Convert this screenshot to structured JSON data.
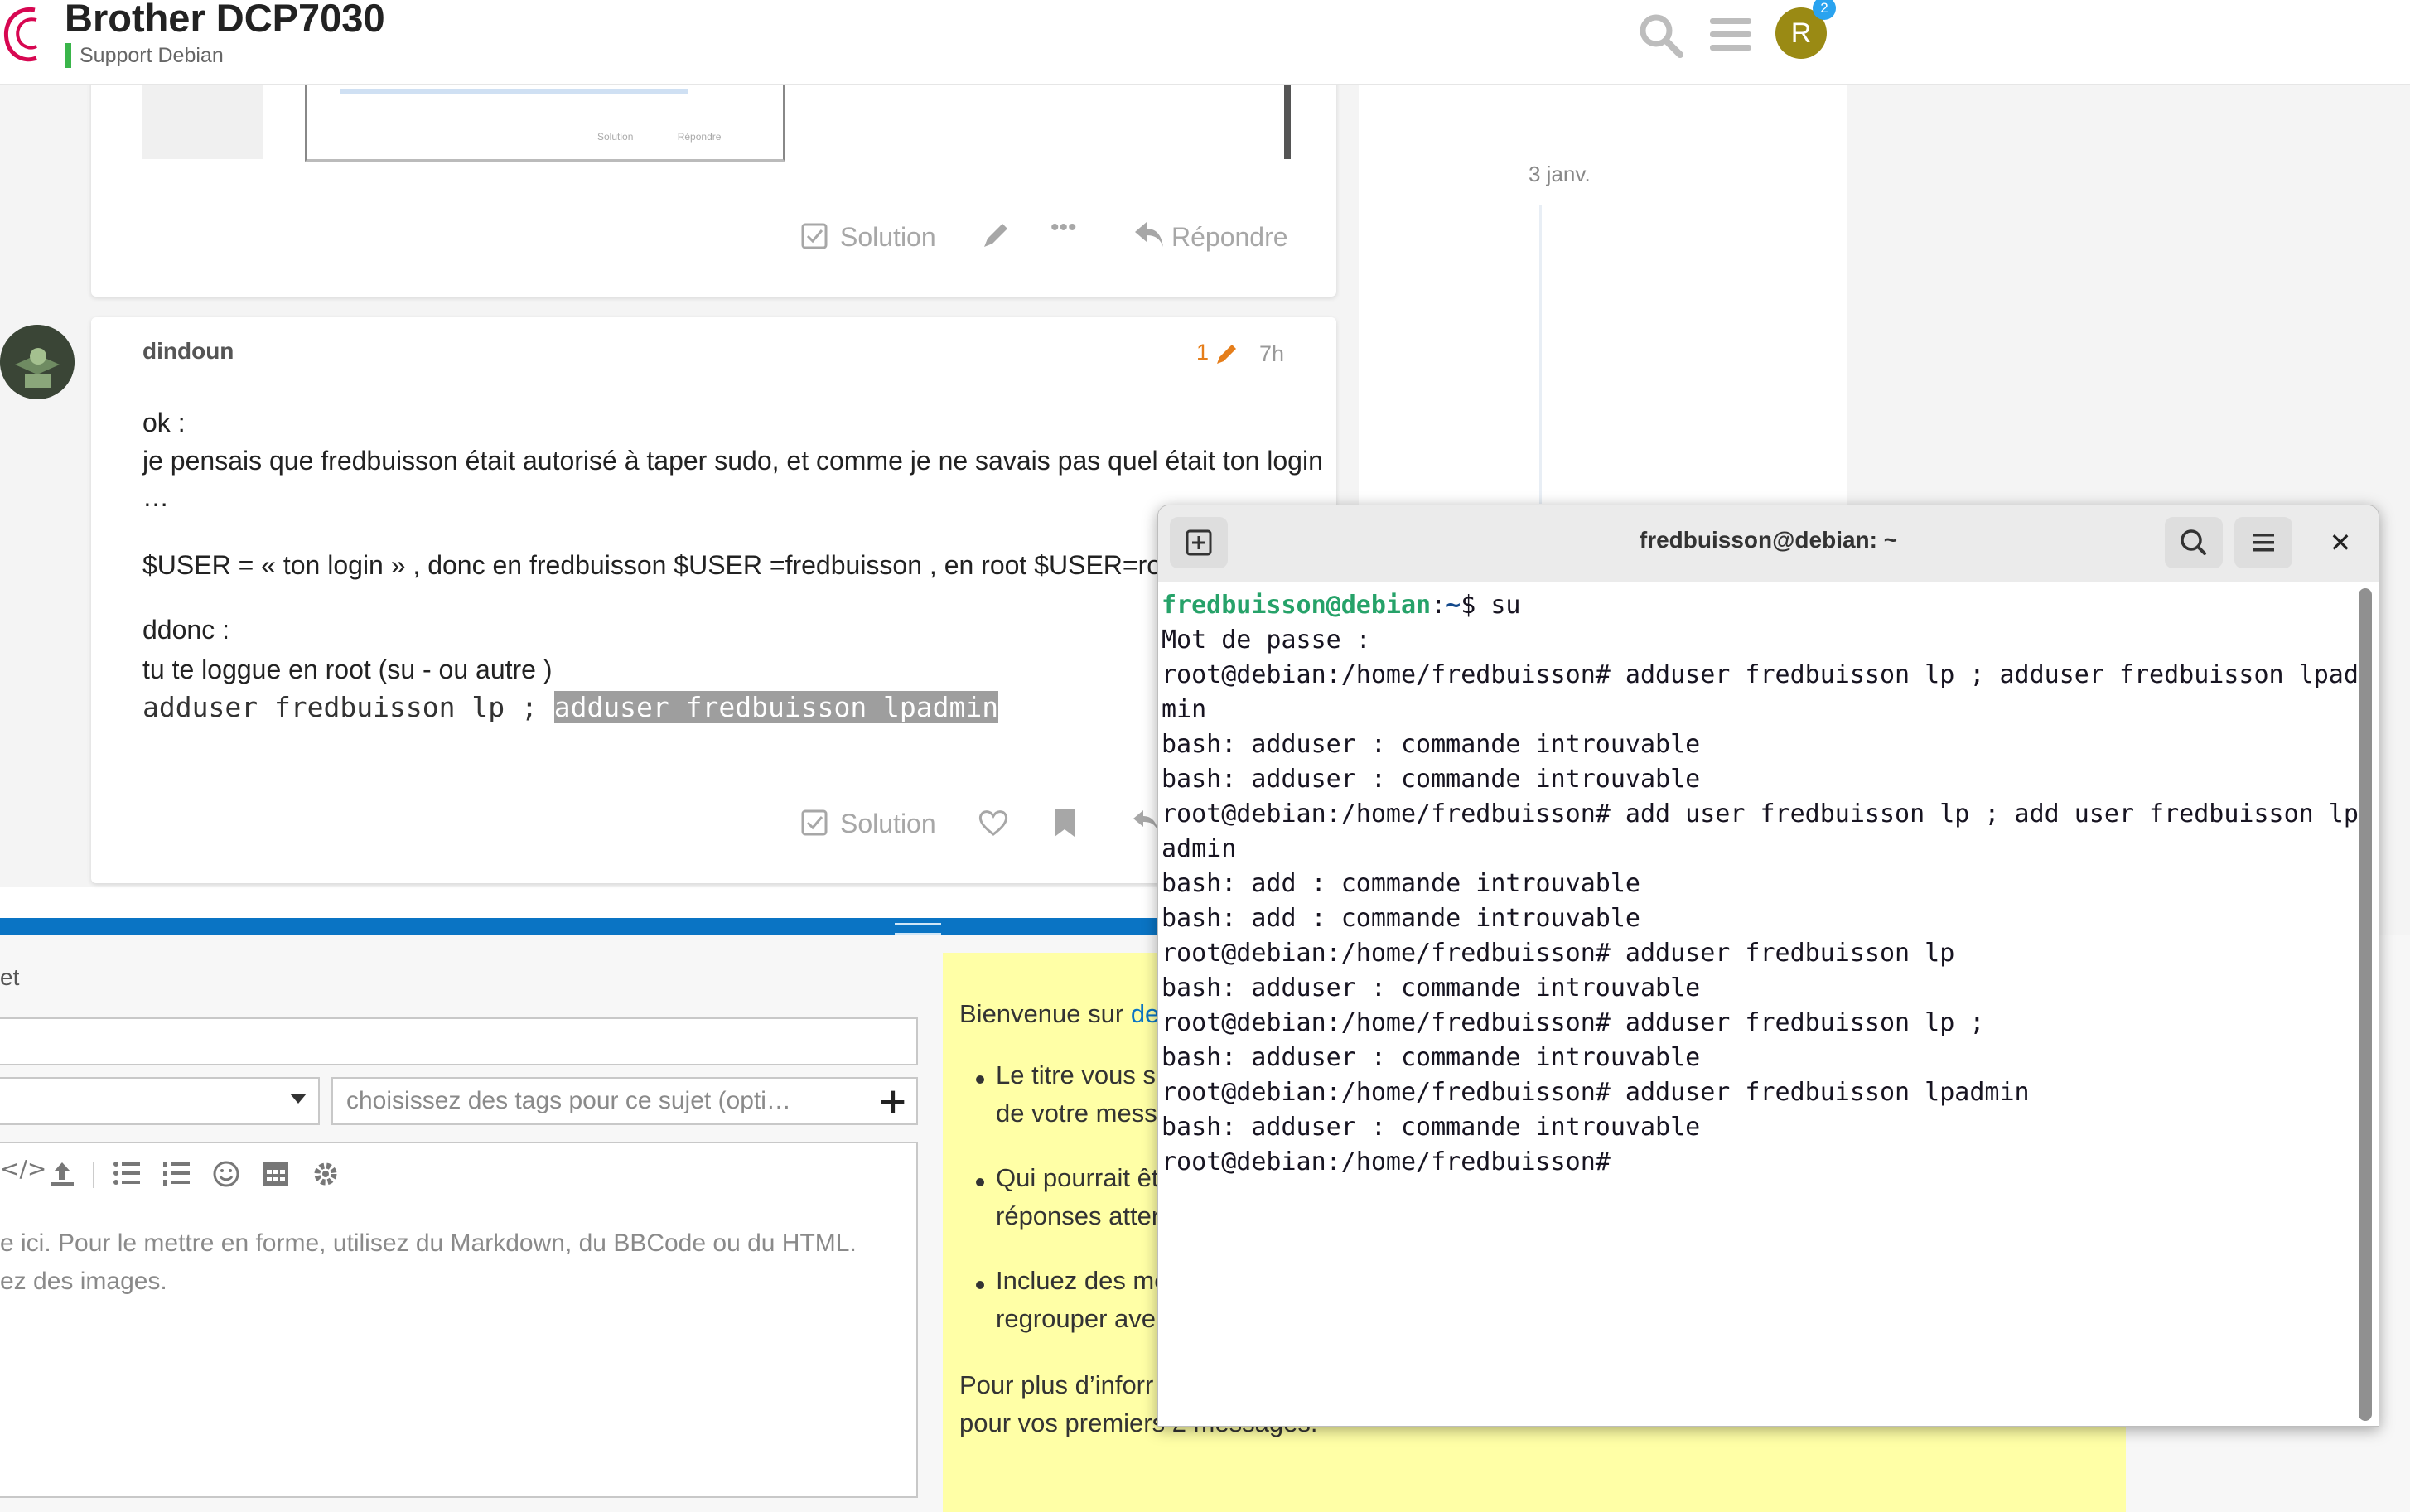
{
  "header": {
    "topic_title": "Brother DCP7030",
    "category": "Support Debian",
    "avatar_letter": "R",
    "notification_count": "2",
    "brand_color": "#d70751",
    "category_color": "#3ab54a"
  },
  "post1": {
    "thumb_solution": "Solution",
    "thumb_reply": "Répondre",
    "actions": {
      "solution_label": "Solution",
      "reply_label": "Répondre"
    }
  },
  "timeline": {
    "date": "3 janv."
  },
  "post2": {
    "username": "dindoun",
    "edit_count": "1",
    "age": "7h",
    "lines": [
      "ok :",
      "je pensais que fredbuisson était autorisé à taper sudo, et comme je ne savais pas quel était ton login",
      "…",
      "$USER = « ton login » , donc en fredbuisson $USER =fredbuisson , en root $USER=root",
      "ddonc :",
      "tu te loggue en root (su - ou autre )"
    ],
    "code_plain": "adduser fredbuisson lp ; ",
    "code_selected": "adduser fredbuisson lpadmin",
    "actions": {
      "solution_label": "Solution"
    }
  },
  "composer": {
    "title_label_fragment": "et",
    "tags_placeholder": "choisissez des tags pour ce sujet (opti…",
    "editor_placeholder_line1": "e ici. Pour le mettre en forme, utilisez du Markdown, du BBCode ou du HTML.",
    "editor_placeholder_line2": "ez des images.",
    "toolbar_icons": [
      "code-icon",
      "upload-icon",
      "bullet-list-icon",
      "numbered-list-icon",
      "emoji-icon",
      "calendar-icon",
      "gear-icon"
    ]
  },
  "tips": {
    "intro_text": "Bienvenue sur ",
    "intro_link": "de",
    "items": [
      {
        "line1": "Le titre vous se",
        "line2": "de votre messa"
      },
      {
        "line1": "Qui pourrait êt",
        "line2": "réponses atter"
      },
      {
        "line1": "Incluez des mo",
        "line2": "regrouper ave"
      }
    ],
    "footer_line1": "Pour plus d’inforr",
    "footer_line2": "pour vos premiers 2 messages."
  },
  "terminal": {
    "title": "fredbuisson@debian: ~",
    "prompt_user": "fredbuisson@debian",
    "prompt_sep": ":",
    "prompt_path": "~",
    "prompt_cmd": "$ su",
    "lines": [
      "Mot de passe :",
      "root@debian:/home/fredbuisson# adduser fredbuisson lp ; adduser fredbuisson lpad",
      "min",
      "bash: adduser : commande introuvable",
      "bash: adduser : commande introuvable",
      "root@debian:/home/fredbuisson# add user fredbuisson lp ; add user fredbuisson lp",
      "admin",
      "bash: add : commande introuvable",
      "bash: add : commande introuvable",
      "root@debian:/home/fredbuisson# adduser fredbuisson lp",
      "bash: adduser : commande introuvable",
      "root@debian:/home/fredbuisson# adduser fredbuisson lp ;",
      "bash: adduser : commande introuvable",
      "root@debian:/home/fredbuisson# adduser fredbuisson lpadmin",
      "bash: adduser : commande introuvable",
      "root@debian:/home/fredbuisson#"
    ],
    "prompt_user_color": "#26a269",
    "prompt_path_color": "#12488b"
  }
}
